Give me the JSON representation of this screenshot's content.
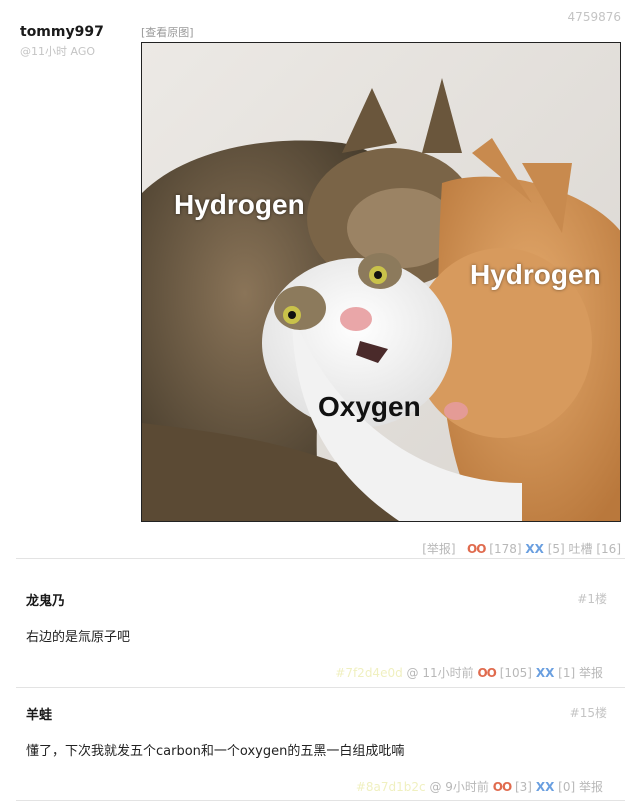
{
  "post": {
    "id": "4759876",
    "author": "tommy997",
    "time": "@11小时 AGO",
    "view_original": "[查看原图]",
    "captions": [
      "Hydrogen",
      "Hydrogen",
      "Oxygen"
    ],
    "actions": {
      "report": "[举报]",
      "oo_label": "OO",
      "oo_count": "[178]",
      "xx_label": "XX",
      "xx_count": "[5]",
      "tucao": "吐槽 [16]"
    }
  },
  "comments": [
    {
      "name": "龙鬼乃",
      "floor": "#1楼",
      "text": "右边的是氚原子吧",
      "uid": "#7f2d4e0d",
      "at": "@",
      "time": "11小时前",
      "oo_label": "OO",
      "oo_count": "[105]",
      "xx_label": "XX",
      "xx_count": "[1]",
      "report": "举报"
    },
    {
      "name": "羊蛙",
      "floor": "#15楼",
      "text": "懂了，下次我就发五个carbon和一个oxygen的五黑一白组成吡喃",
      "uid": "#8a7d1b2c",
      "at": "@",
      "time": "9小时前",
      "oo_label": "OO",
      "oo_count": "[3]",
      "xx_label": "XX",
      "xx_count": "[0]",
      "report": "举报"
    }
  ]
}
